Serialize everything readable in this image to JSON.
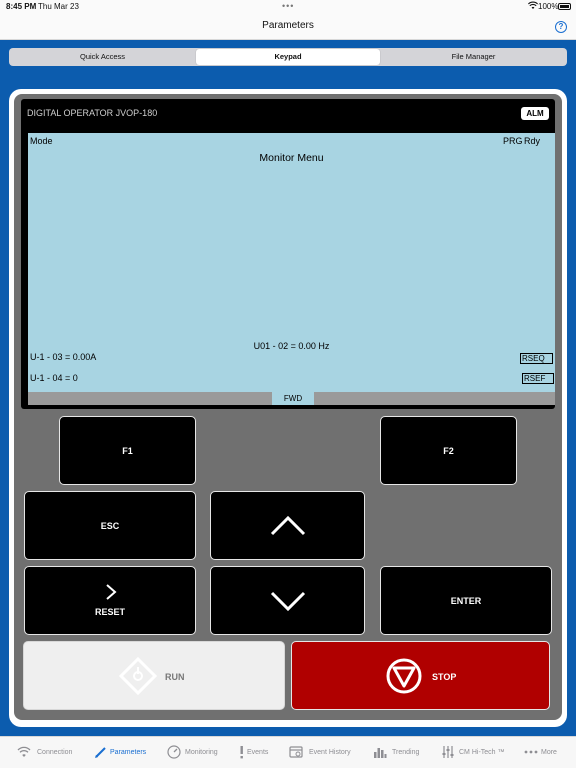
{
  "status_bar": {
    "time": "8:45 PM",
    "date": "Thu Mar 23",
    "battery": "100%"
  },
  "nav": {
    "title": "Parameters",
    "help_icon": "question-circle-icon"
  },
  "segments": {
    "tabs": [
      "Quick Access",
      "Keypad",
      "File Manager"
    ],
    "selected": "Keypad"
  },
  "operator": {
    "device_label": "DIGITAL OPERATOR JVOP-180",
    "alm_badge": "ALM",
    "lcd": {
      "mode": "Mode",
      "prg": "PRG",
      "rdy": "Rdy",
      "menu_title": "Monitor Menu",
      "monitor_line": "U01 - 02 = 0.00 Hz",
      "u1_03": "U-1 - 03 = 0.00A",
      "u1_04": "U-1 - 04 = 0",
      "rseq": "RSEQ",
      "rsef": "RSEF",
      "direction": "FWD"
    },
    "keys": {
      "f1": "F1",
      "f2": "F2",
      "esc": "ESC",
      "reset": "RESET",
      "enter": "ENTER",
      "run": "RUN",
      "stop": "STOP"
    }
  },
  "tab_bar": {
    "items": [
      {
        "label": "Connection",
        "icon": "wifi-icon"
      },
      {
        "label": "Parameters",
        "icon": "pencil-icon"
      },
      {
        "label": "Monitoring",
        "icon": "gauge-icon"
      },
      {
        "label": "Events",
        "icon": "exclamation-icon"
      },
      {
        "label": "Event History",
        "icon": "history-icon"
      },
      {
        "label": "Trending",
        "icon": "bar-chart-icon"
      },
      {
        "label": "CM Hi-Tech ™",
        "icon": "sliders-icon"
      },
      {
        "label": "More",
        "icon": "ellipsis-icon"
      }
    ],
    "active": "Parameters"
  },
  "colors": {
    "brand_blue": "#0c5cae",
    "lcd_background": "#a8d4e2",
    "stop_red": "#b00000",
    "active_tab": "#1a6fd1"
  }
}
